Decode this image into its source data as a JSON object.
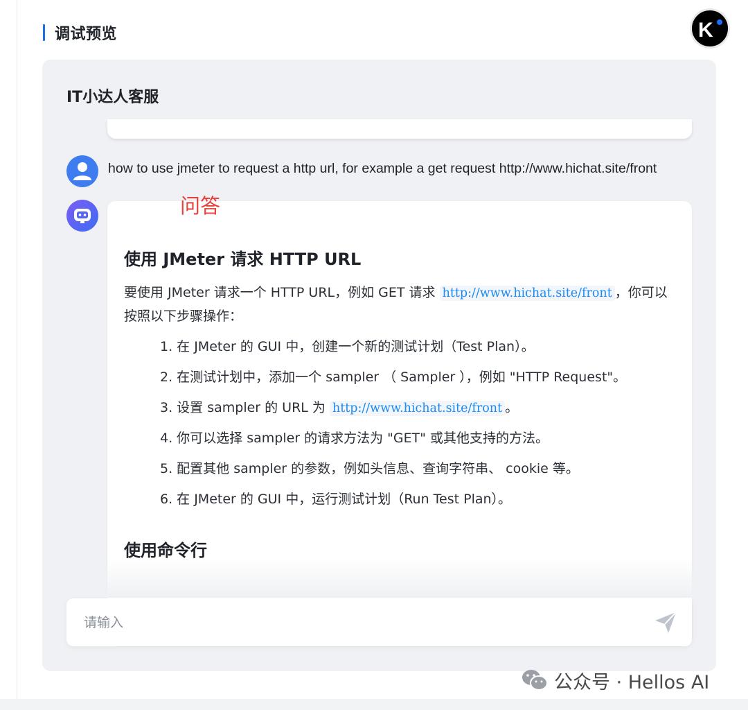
{
  "section": {
    "title": "调试预览"
  },
  "logo": {
    "icon": "k-logo-icon"
  },
  "chat": {
    "bot_name": "IT小达人客服",
    "user_message": "how to use jmeter to request a http url, for example a get request http://www.hichat.site/front",
    "annotation": "问答",
    "answer": {
      "heading": "使用 JMeter 请求 HTTP URL",
      "intro_prefix": "要使用 JMeter 请求一个 HTTP URL，例如 GET 请求 ",
      "intro_code": "http://www.hichat.site/front",
      "intro_suffix": "，你可以按照以下步骤操作：",
      "steps": [
        {
          "text": "1. 在 JMeter 的 GUI 中，创建一个新的测试计划（Test Plan）。"
        },
        {
          "text": "2. 在测试计划中，添加一个 sampler （ Sampler ），例如 \"HTTP Request\"。"
        },
        {
          "prefix": "3. 设置 sampler 的 URL 为 ",
          "code": "http://www.hichat.site/front",
          "suffix": "。"
        },
        {
          "text": "4. 你可以选择 sampler 的请求方法为 \"GET\" 或其他支持的方法。"
        },
        {
          "text": "5. 配置其他 sampler 的参数，例如头信息、查询字符串、 cookie 等。"
        },
        {
          "text": "6. 在 JMeter 的 GUI 中，运行测试计划（Run Test Plan）。"
        }
      ],
      "heading2": "使用命令行"
    }
  },
  "input": {
    "placeholder": "请输入",
    "value": ""
  },
  "watermark": {
    "text": "公众号 · Hellos AI"
  },
  "colors": {
    "accent": "#1a73e8",
    "code": "#1d8bf1",
    "annotation": "#e8413a",
    "panel_bg": "#f0f1f4"
  }
}
